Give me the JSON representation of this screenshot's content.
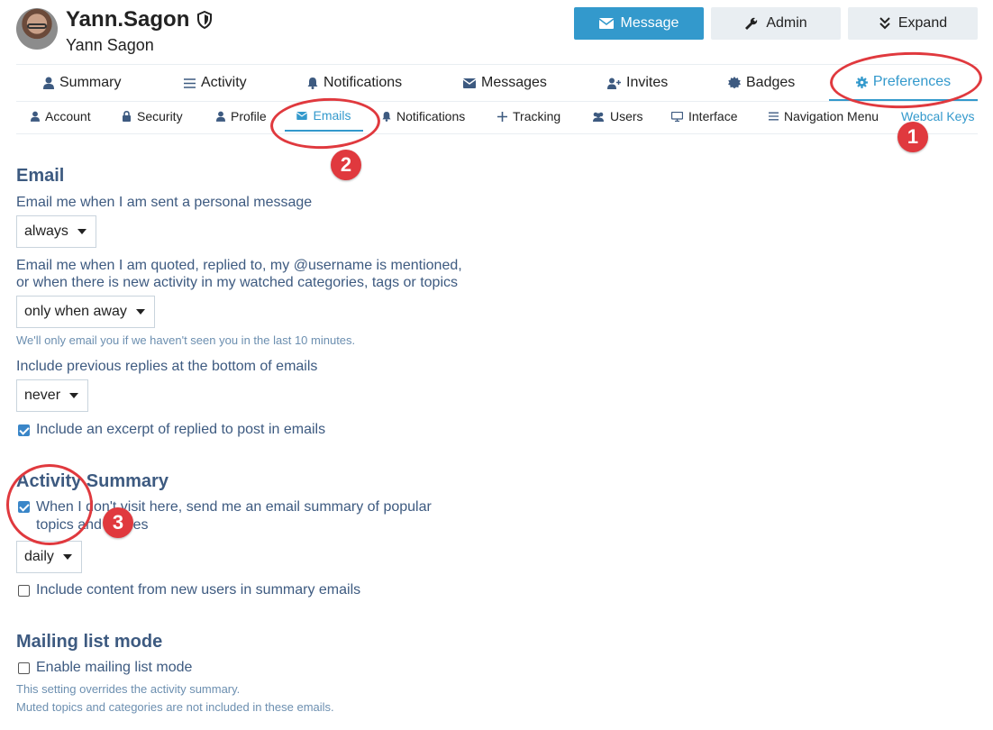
{
  "user": {
    "username": "Yann.Sagon",
    "full_name": "Yann Sagon"
  },
  "header_buttons": {
    "message": "Message",
    "admin": "Admin",
    "expand": "Expand"
  },
  "main_tabs": [
    "Summary",
    "Activity",
    "Notifications",
    "Messages",
    "Invites",
    "Badges",
    "Preferences"
  ],
  "sub_tabs": [
    "Account",
    "Security",
    "Profile",
    "Emails",
    "Notifications",
    "Tracking",
    "Users",
    "Interface",
    "Navigation Menu",
    "Webcal Keys"
  ],
  "email": {
    "heading": "Email",
    "personal_message_label": "Email me when I am sent a personal message",
    "personal_message_value": "always",
    "quoted_label_line1": "Email me when I am quoted, replied to, my @username is mentioned,",
    "quoted_label_line2": "or when there is new activity in my watched categories, tags or topics",
    "quoted_value": "only when away",
    "quoted_hint": "We'll only email you if we haven't seen you in the last 10 minutes.",
    "previous_replies_label": "Include previous replies at the bottom of emails",
    "previous_replies_value": "never",
    "excerpt_label": "Include an excerpt of replied to post in emails",
    "excerpt_checked": true
  },
  "activity_summary": {
    "heading": "Activity Summary",
    "summary_label_line1": "When I don't visit here, send me an email summary of popular",
    "summary_label_line2": "topics and replies",
    "summary_checked": true,
    "frequency_value": "daily",
    "new_users_label": "Include content from new users in summary emails",
    "new_users_checked": false
  },
  "mailing_list": {
    "heading": "Mailing list mode",
    "enable_label": "Enable mailing list mode",
    "enable_checked": false,
    "hint_line1": "This setting overrides the activity summary.",
    "hint_line2": "Muted topics and categories are not included in these emails."
  },
  "annotations": [
    "1",
    "2",
    "3"
  ],
  "colors": {
    "accent": "#3399cc",
    "annotation_red": "#e0393e",
    "text_blue": "#3d5a80"
  },
  "icons": {
    "shield": "shield-icon",
    "message": "envelope-icon",
    "admin": "wrench-icon",
    "expand": "double-chevron-down-icon",
    "summary": "user-icon",
    "activity": "list-icon",
    "notifications": "bell-icon",
    "messages": "envelope-icon",
    "invites": "user-plus-icon",
    "badges": "certificate-icon",
    "preferences": "gear-icon"
  }
}
